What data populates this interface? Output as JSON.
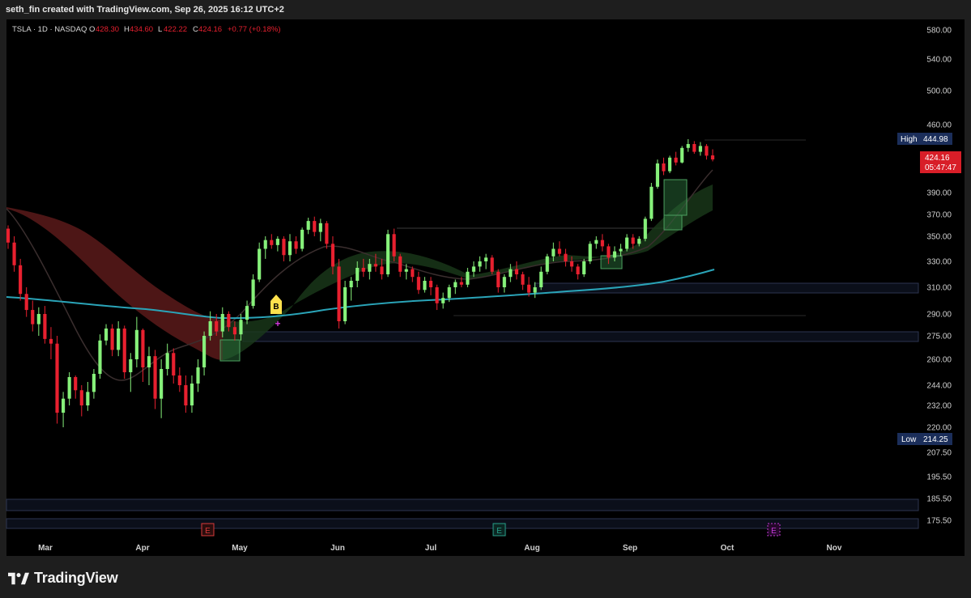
{
  "header": {
    "attribution": "seth_fin created with TradingView.com, Sep 26, 2025 16:12 UTC+2"
  },
  "legend": {
    "symbol": "TSLA · 1D · NASDAQ",
    "o_label": "O",
    "o_value": "428.30",
    "h_label": "H",
    "h_value": "434.60",
    "l_label": "L",
    "l_value": "422.22",
    "c_label": "C",
    "c_value": "424.16",
    "change": "+0.77 (+0.18%)"
  },
  "footer": {
    "brand": "TradingView"
  },
  "colors": {
    "up": "#86f07a",
    "down": "#e8202f",
    "ma_teal": "#2aa4b8",
    "ribbon_red": "#6b2121",
    "ribbon_green": "#1f3d1f",
    "badge_high": "#1b2e5a",
    "badge_price": "#d81e28",
    "signal": "#ffe14d",
    "plus": "#d63adf",
    "earnings_red": "#d83a3a",
    "earnings_green": "#27a08a",
    "earnings_purple": "#c33ad6"
  },
  "chart_data": {
    "type": "candlestick",
    "symbol": "TSLA",
    "interval": "1D",
    "exchange": "NASDAQ",
    "y_axis_ticks": [
      "580.00",
      "540.00",
      "500.00",
      "460.00",
      "390.00",
      "370.00",
      "350.00",
      "330.00",
      "310.00",
      "290.00",
      "275.00",
      "260.00",
      "244.00",
      "232.00",
      "220.00",
      "207.50",
      "195.50",
      "185.50",
      "175.50"
    ],
    "x_axis_ticks": [
      "Mar",
      "Apr",
      "May",
      "Jun",
      "Jul",
      "Aug",
      "Sep",
      "Oct",
      "Nov"
    ],
    "high_label": "High",
    "high_value": "444.98",
    "low_label": "Low",
    "low_value": "214.25",
    "last_price": "424.16",
    "countdown": "05:47:47",
    "signal_label": "B",
    "earnings_label": "E",
    "candles": [
      {
        "o": 357,
        "h": 360,
        "l": 340,
        "c": 345
      },
      {
        "o": 345,
        "h": 350,
        "l": 322,
        "c": 327
      },
      {
        "o": 327,
        "h": 332,
        "l": 300,
        "c": 305
      },
      {
        "o": 305,
        "h": 310,
        "l": 288,
        "c": 293
      },
      {
        "o": 293,
        "h": 300,
        "l": 278,
        "c": 283
      },
      {
        "o": 283,
        "h": 295,
        "l": 275,
        "c": 290
      },
      {
        "o": 290,
        "h": 296,
        "l": 270,
        "c": 273
      },
      {
        "o": 273,
        "h": 281,
        "l": 260,
        "c": 270
      },
      {
        "o": 270,
        "h": 275,
        "l": 222,
        "c": 228
      },
      {
        "o": 228,
        "h": 240,
        "l": 220,
        "c": 236
      },
      {
        "o": 236,
        "h": 252,
        "l": 232,
        "c": 249
      },
      {
        "o": 249,
        "h": 250,
        "l": 236,
        "c": 241
      },
      {
        "o": 241,
        "h": 244,
        "l": 226,
        "c": 232
      },
      {
        "o": 232,
        "h": 246,
        "l": 229,
        "c": 240
      },
      {
        "o": 240,
        "h": 254,
        "l": 236,
        "c": 251
      },
      {
        "o": 251,
        "h": 276,
        "l": 248,
        "c": 272
      },
      {
        "o": 272,
        "h": 283,
        "l": 269,
        "c": 280
      },
      {
        "o": 280,
        "h": 283,
        "l": 262,
        "c": 266
      },
      {
        "o": 266,
        "h": 285,
        "l": 262,
        "c": 280
      },
      {
        "o": 280,
        "h": 282,
        "l": 248,
        "c": 252
      },
      {
        "o": 252,
        "h": 264,
        "l": 240,
        "c": 260
      },
      {
        "o": 260,
        "h": 288,
        "l": 255,
        "c": 279
      },
      {
        "o": 279,
        "h": 280,
        "l": 246,
        "c": 255
      },
      {
        "o": 255,
        "h": 268,
        "l": 244,
        "c": 262
      },
      {
        "o": 262,
        "h": 266,
        "l": 230,
        "c": 236
      },
      {
        "o": 236,
        "h": 260,
        "l": 225,
        "c": 254
      },
      {
        "o": 254,
        "h": 270,
        "l": 250,
        "c": 264
      },
      {
        "o": 264,
        "h": 267,
        "l": 245,
        "c": 250
      },
      {
        "o": 250,
        "h": 255,
        "l": 240,
        "c": 244
      },
      {
        "o": 244,
        "h": 250,
        "l": 228,
        "c": 232
      },
      {
        "o": 232,
        "h": 250,
        "l": 228,
        "c": 245
      },
      {
        "o": 245,
        "h": 260,
        "l": 240,
        "c": 255
      },
      {
        "o": 255,
        "h": 278,
        "l": 250,
        "c": 275
      },
      {
        "o": 275,
        "h": 292,
        "l": 272,
        "c": 285
      },
      {
        "o": 285,
        "h": 290,
        "l": 275,
        "c": 278
      },
      {
        "o": 278,
        "h": 295,
        "l": 274,
        "c": 290
      },
      {
        "o": 290,
        "h": 292,
        "l": 278,
        "c": 281
      },
      {
        "o": 281,
        "h": 285,
        "l": 272,
        "c": 276
      },
      {
        "o": 276,
        "h": 290,
        "l": 272,
        "c": 286
      },
      {
        "o": 286,
        "h": 300,
        "l": 283,
        "c": 296
      },
      {
        "o": 296,
        "h": 320,
        "l": 294,
        "c": 316
      },
      {
        "o": 316,
        "h": 345,
        "l": 314,
        "c": 340
      },
      {
        "o": 340,
        "h": 350,
        "l": 332,
        "c": 347
      },
      {
        "o": 347,
        "h": 352,
        "l": 340,
        "c": 343
      },
      {
        "o": 343,
        "h": 350,
        "l": 338,
        "c": 348
      },
      {
        "o": 348,
        "h": 350,
        "l": 330,
        "c": 335
      },
      {
        "o": 335,
        "h": 352,
        "l": 330,
        "c": 346
      },
      {
        "o": 346,
        "h": 350,
        "l": 336,
        "c": 340
      },
      {
        "o": 340,
        "h": 358,
        "l": 338,
        "c": 356
      },
      {
        "o": 356,
        "h": 367,
        "l": 352,
        "c": 364
      },
      {
        "o": 364,
        "h": 368,
        "l": 350,
        "c": 354
      },
      {
        "o": 354,
        "h": 366,
        "l": 346,
        "c": 362
      },
      {
        "o": 362,
        "h": 364,
        "l": 340,
        "c": 344
      },
      {
        "o": 344,
        "h": 350,
        "l": 320,
        "c": 326
      },
      {
        "o": 326,
        "h": 332,
        "l": 280,
        "c": 285
      },
      {
        "o": 285,
        "h": 315,
        "l": 283,
        "c": 310
      },
      {
        "o": 310,
        "h": 318,
        "l": 300,
        "c": 315
      },
      {
        "o": 315,
        "h": 330,
        "l": 310,
        "c": 325
      },
      {
        "o": 325,
        "h": 332,
        "l": 318,
        "c": 322
      },
      {
        "o": 322,
        "h": 332,
        "l": 316,
        "c": 328
      },
      {
        "o": 328,
        "h": 336,
        "l": 322,
        "c": 326
      },
      {
        "o": 326,
        "h": 332,
        "l": 316,
        "c": 320
      },
      {
        "o": 320,
        "h": 356,
        "l": 318,
        "c": 352
      },
      {
        "o": 352,
        "h": 357,
        "l": 330,
        "c": 334
      },
      {
        "o": 334,
        "h": 336,
        "l": 318,
        "c": 322
      },
      {
        "o": 322,
        "h": 328,
        "l": 316,
        "c": 324
      },
      {
        "o": 324,
        "h": 326,
        "l": 314,
        "c": 318
      },
      {
        "o": 318,
        "h": 322,
        "l": 305,
        "c": 308
      },
      {
        "o": 308,
        "h": 318,
        "l": 306,
        "c": 315
      },
      {
        "o": 315,
        "h": 318,
        "l": 304,
        "c": 310
      },
      {
        "o": 310,
        "h": 312,
        "l": 293,
        "c": 298
      },
      {
        "o": 298,
        "h": 306,
        "l": 294,
        "c": 302
      },
      {
        "o": 302,
        "h": 312,
        "l": 299,
        "c": 310
      },
      {
        "o": 310,
        "h": 316,
        "l": 305,
        "c": 314
      },
      {
        "o": 314,
        "h": 318,
        "l": 310,
        "c": 312
      },
      {
        "o": 312,
        "h": 325,
        "l": 310,
        "c": 322
      },
      {
        "o": 322,
        "h": 330,
        "l": 318,
        "c": 326
      },
      {
        "o": 326,
        "h": 334,
        "l": 322,
        "c": 330
      },
      {
        "o": 330,
        "h": 336,
        "l": 324,
        "c": 333
      },
      {
        "o": 333,
        "h": 335,
        "l": 320,
        "c": 322
      },
      {
        "o": 322,
        "h": 324,
        "l": 306,
        "c": 310
      },
      {
        "o": 310,
        "h": 320,
        "l": 306,
        "c": 318
      },
      {
        "o": 318,
        "h": 328,
        "l": 314,
        "c": 324
      },
      {
        "o": 324,
        "h": 330,
        "l": 316,
        "c": 320
      },
      {
        "o": 320,
        "h": 322,
        "l": 308,
        "c": 312
      },
      {
        "o": 312,
        "h": 318,
        "l": 303,
        "c": 306
      },
      {
        "o": 306,
        "h": 314,
        "l": 302,
        "c": 310
      },
      {
        "o": 310,
        "h": 326,
        "l": 308,
        "c": 322
      },
      {
        "o": 322,
        "h": 336,
        "l": 320,
        "c": 334
      },
      {
        "o": 334,
        "h": 345,
        "l": 330,
        "c": 340
      },
      {
        "o": 340,
        "h": 346,
        "l": 334,
        "c": 336
      },
      {
        "o": 336,
        "h": 340,
        "l": 326,
        "c": 330
      },
      {
        "o": 330,
        "h": 334,
        "l": 322,
        "c": 326
      },
      {
        "o": 326,
        "h": 328,
        "l": 316,
        "c": 320
      },
      {
        "o": 320,
        "h": 332,
        "l": 318,
        "c": 330
      },
      {
        "o": 330,
        "h": 346,
        "l": 328,
        "c": 344
      },
      {
        "o": 344,
        "h": 350,
        "l": 340,
        "c": 347
      },
      {
        "o": 347,
        "h": 352,
        "l": 338,
        "c": 342
      },
      {
        "o": 342,
        "h": 344,
        "l": 328,
        "c": 333
      },
      {
        "o": 333,
        "h": 342,
        "l": 330,
        "c": 338
      },
      {
        "o": 338,
        "h": 344,
        "l": 334,
        "c": 340
      },
      {
        "o": 340,
        "h": 352,
        "l": 338,
        "c": 349
      },
      {
        "o": 349,
        "h": 352,
        "l": 340,
        "c": 344
      },
      {
        "o": 344,
        "h": 350,
        "l": 342,
        "c": 348
      },
      {
        "o": 348,
        "h": 368,
        "l": 346,
        "c": 366
      },
      {
        "o": 366,
        "h": 400,
        "l": 364,
        "c": 396
      },
      {
        "o": 396,
        "h": 424,
        "l": 394,
        "c": 420
      },
      {
        "o": 420,
        "h": 426,
        "l": 408,
        "c": 412
      },
      {
        "o": 412,
        "h": 428,
        "l": 410,
        "c": 426
      },
      {
        "o": 426,
        "h": 432,
        "l": 418,
        "c": 421
      },
      {
        "o": 421,
        "h": 438,
        "l": 420,
        "c": 436
      },
      {
        "o": 436,
        "h": 445,
        "l": 432,
        "c": 440
      },
      {
        "o": 440,
        "h": 443,
        "l": 430,
        "c": 432
      },
      {
        "o": 432,
        "h": 442,
        "l": 428,
        "c": 438
      },
      {
        "o": 438,
        "h": 440,
        "l": 424,
        "c": 428
      },
      {
        "o": 428.3,
        "h": 434.6,
        "l": 422.22,
        "c": 424.16
      }
    ]
  }
}
